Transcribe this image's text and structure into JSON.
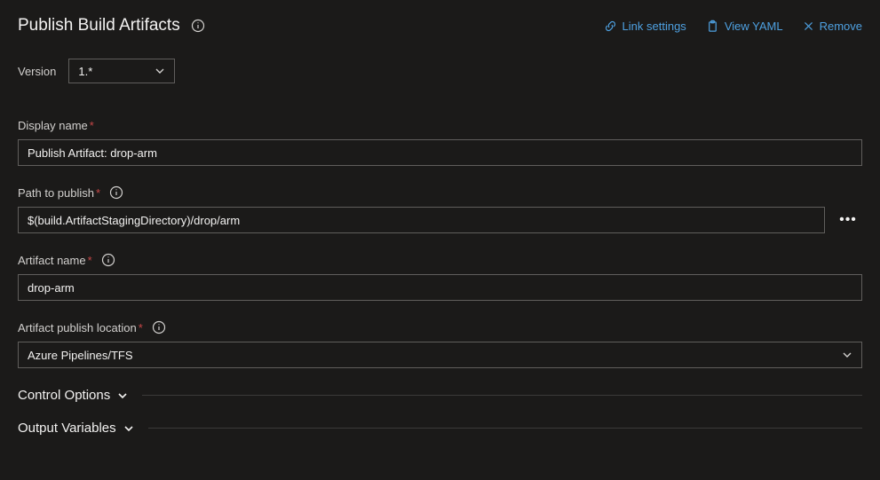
{
  "header": {
    "title": "Publish Build Artifacts",
    "actions": {
      "link_settings": "Link settings",
      "view_yaml": "View YAML",
      "remove": "Remove"
    }
  },
  "version": {
    "label": "Version",
    "value": "1.*"
  },
  "fields": {
    "display_name": {
      "label": "Display name",
      "value": "Publish Artifact: drop-arm"
    },
    "path_to_publish": {
      "label": "Path to publish",
      "value": "$(build.ArtifactStagingDirectory)/drop/arm"
    },
    "artifact_name": {
      "label": "Artifact name",
      "value": "drop-arm"
    },
    "publish_location": {
      "label": "Artifact publish location",
      "value": "Azure Pipelines/TFS"
    }
  },
  "sections": {
    "control_options": "Control Options",
    "output_variables": "Output Variables"
  }
}
